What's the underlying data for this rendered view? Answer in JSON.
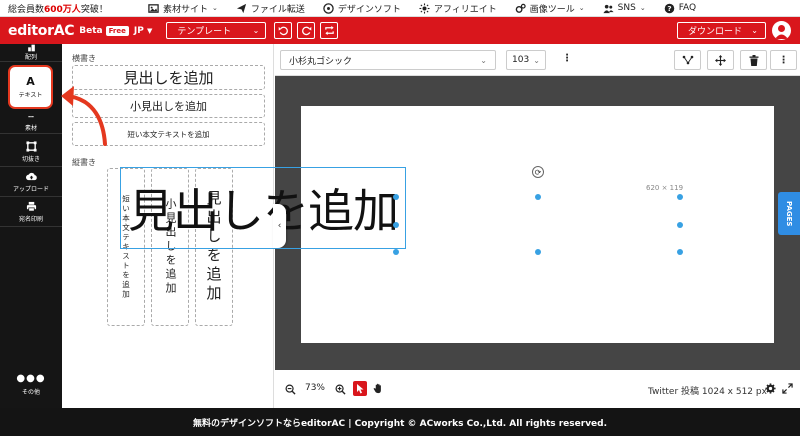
{
  "topbar": {
    "members_prefix": "総会員数",
    "members_count": "600万人",
    "members_suffix": "突破！",
    "links": [
      {
        "label": "素材サイト",
        "icon": "grid-icon",
        "has_caret": true
      },
      {
        "label": "ファイル転送",
        "icon": "paper-plane-icon",
        "has_caret": false
      },
      {
        "label": "デザインソフト",
        "icon": "design-icon",
        "has_caret": false
      },
      {
        "label": "アフィリエイト",
        "icon": "sun-icon",
        "has_caret": false
      },
      {
        "label": "画像ツール",
        "icon": "gears-icon",
        "has_caret": true
      },
      {
        "label": "SNS",
        "icon": "people-icon",
        "has_caret": true
      },
      {
        "label": "FAQ",
        "icon": "question-icon",
        "has_caret": false
      }
    ]
  },
  "header": {
    "logo": "editorAC",
    "beta": "Beta",
    "free": "Free",
    "lang": "JP",
    "template_label": "テンプレート",
    "download_label": "ダウンロード"
  },
  "rail": {
    "items": [
      {
        "name": "layout",
        "label": "配列"
      },
      {
        "name": "text",
        "label": "テキスト",
        "glyph": "A"
      },
      {
        "name": "material",
        "label": "素材"
      },
      {
        "name": "crop",
        "label": "切抜き"
      },
      {
        "name": "upload",
        "label": "アップロード"
      },
      {
        "name": "print",
        "label": "宛名印刷"
      }
    ],
    "other_label": "その他"
  },
  "panel": {
    "horizontal_label": "横書き",
    "vertical_label": "縦書き",
    "h_heading": "見出しを追加",
    "h_subheading": "小見出しを追加",
    "h_body": "短い本文テキストを追加",
    "v_body": "短い本文テキストを追加",
    "v_subheading": "小見出しを追加",
    "v_heading": "見出しを追加"
  },
  "toolbar": {
    "font_name": "小杉丸ゴシック",
    "font_size": "103"
  },
  "canvas": {
    "headline": "見出しを追加",
    "dimensions": "620 × 119",
    "pages_tab": "PAGES"
  },
  "bottombar": {
    "zoom": "73%",
    "canvas_size": "Twitter 投稿 1024 x 512 px"
  },
  "footer": {
    "text": "無料のデザインソフトならeditorAC | Copyright © ACworks Co.,Ltd. All rights reserved."
  },
  "colors": {
    "brand_red": "#d9161c",
    "highlight_orange": "#e4381f",
    "selection_blue": "#38a1e3",
    "pages_blue": "#2f8de4"
  }
}
